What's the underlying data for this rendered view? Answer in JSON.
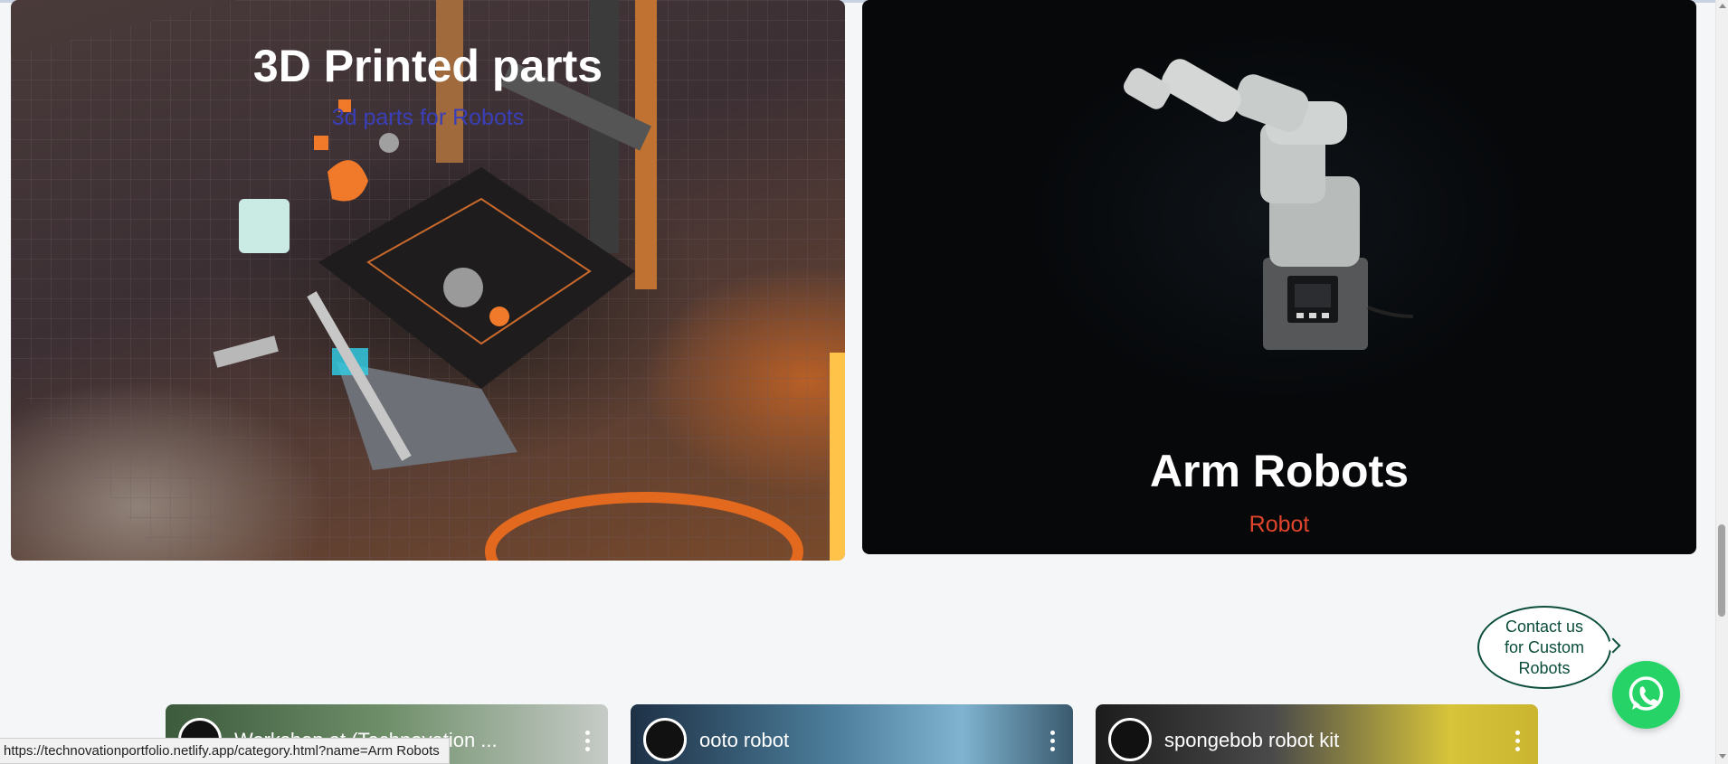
{
  "cards": [
    {
      "title": "3D Printed parts",
      "subtitle": "3d parts for Robots"
    },
    {
      "title": "Arm Robots",
      "subtitle": "Robot"
    }
  ],
  "contact": {
    "text": "Contact us for Custom Robots"
  },
  "videos": [
    {
      "title": "Workshop at (Technovation ..."
    },
    {
      "title": "ooto robot"
    },
    {
      "title": "spongebob robot kit"
    }
  ],
  "status_url": "https://technovationportfolio.netlify.app/category.html?name=Arm Robots",
  "colors": {
    "subtitle_3d": "#3a3fb8",
    "subtitle_arm": "#e0452c",
    "whatsapp": "#25d366",
    "contact_border": "#0b4d3b"
  },
  "icons": [
    "whatsapp-icon",
    "channel-logo-icon",
    "more-vert-icon"
  ]
}
